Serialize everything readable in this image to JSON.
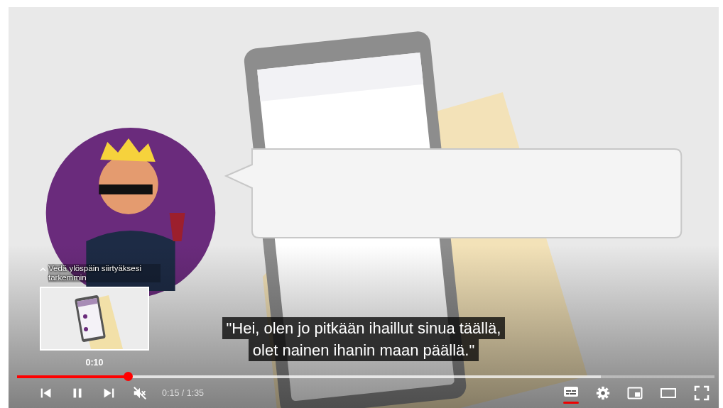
{
  "player": {
    "playing": true,
    "muted": true,
    "captions_on": true,
    "seek_preview": {
      "hint": "Vedä ylöspäin siirtyäksesi tarkemmin",
      "time": "0:10"
    },
    "captions": [
      "\"Hei, olen jo pitkään ihaillut sinua täällä,",
      "olet nainen ihanin maan päällä.\""
    ],
    "progress": {
      "level": 0.159
    },
    "buffer": {
      "level": 0.837
    },
    "time": "0:15 / 1:35"
  }
}
